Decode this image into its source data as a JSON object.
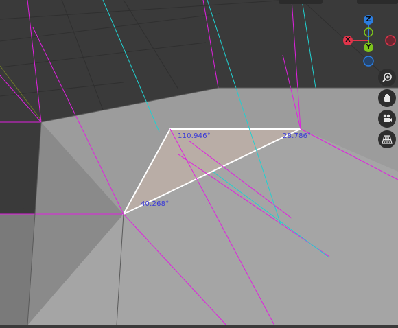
{
  "viewport": {
    "angle_labels": [
      "110.946°",
      "28.786°",
      "40.268°"
    ],
    "colors": {
      "background": "#3a3a3a",
      "mesh_face": "#9a9a9a",
      "selected_face": "#b9ada6",
      "edge_magenta": "#e020e0",
      "edge_cyan": "#20d0d0",
      "angle_text": "#3a3ad8"
    }
  },
  "gizmo": {
    "axes": [
      {
        "label": "Z",
        "color": "#2b7de0"
      },
      {
        "label": "X",
        "color": "#e0344a"
      },
      {
        "label": "Y",
        "color": "#7dc51b"
      }
    ]
  },
  "nav_buttons": [
    {
      "icon": "zoom-icon"
    },
    {
      "icon": "hand-icon"
    },
    {
      "icon": "camera-icon"
    },
    {
      "icon": "grid-icon"
    }
  ]
}
